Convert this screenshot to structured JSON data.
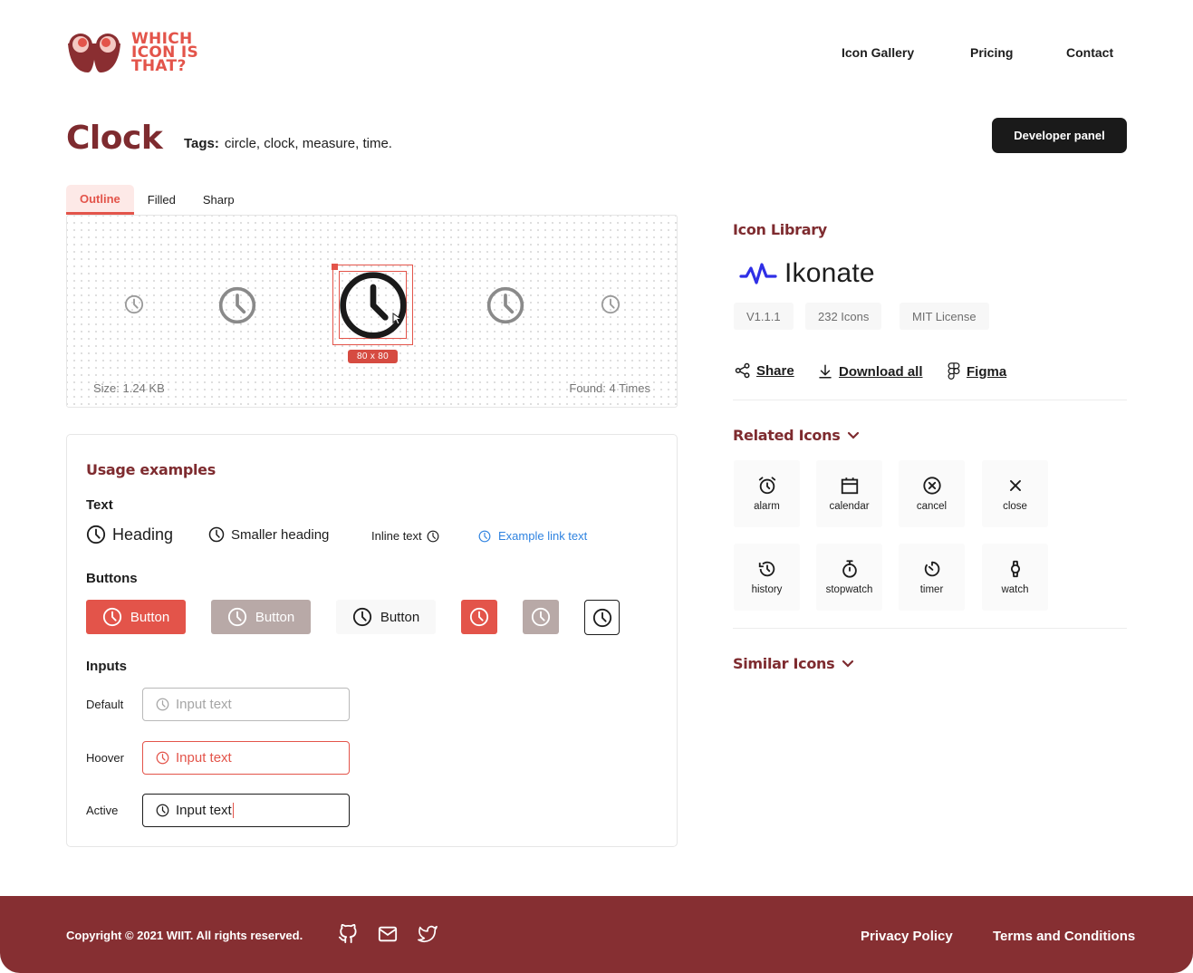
{
  "brand": {
    "logo_text": [
      "WHICH",
      "ICON IS",
      "THAT?"
    ],
    "primary": "#e3544a",
    "dark_accent": "#7e2b2f",
    "footer_bg": "#862f32"
  },
  "nav": {
    "gallery": "Icon Gallery",
    "pricing": "Pricing",
    "contact": "Contact"
  },
  "page": {
    "title": "Clock",
    "tags_label": "Tags:",
    "tags": "circle, clock, measure, time.",
    "developer_button": "Developer panel"
  },
  "tabs": [
    {
      "label": "Outline",
      "active": true
    },
    {
      "label": "Filled",
      "active": false
    },
    {
      "label": "Sharp",
      "active": false
    }
  ],
  "preview": {
    "icon": "clock-icon",
    "size_badge": "80 x 80",
    "size_text": "Size: 1.24 KB",
    "found_text": "Found: 4 Times"
  },
  "usage": {
    "title": "Usage examples",
    "text_section": {
      "label": "Text",
      "heading": "Heading",
      "smaller_heading": "Smaller heading",
      "inline_text": "Inline text",
      "link_text": "Example link text"
    },
    "buttons_section": {
      "label": "Buttons",
      "button_label": "Button"
    },
    "inputs_section": {
      "label": "Inputs",
      "rows": [
        {
          "label": "Default",
          "value": "Input text",
          "state": "default"
        },
        {
          "label": "Hoover",
          "value": "Input text",
          "state": "hover"
        },
        {
          "label": "Active",
          "value": "Input text",
          "state": "active"
        }
      ]
    }
  },
  "library": {
    "title": "Icon Library",
    "name": "Ikonate",
    "version": "V1.1.1",
    "count": "232 Icons",
    "license": "MIT License",
    "actions": {
      "share": "Share",
      "download": "Download all",
      "figma": "Figma"
    }
  },
  "related": {
    "title": "Related Icons",
    "items": [
      {
        "label": "alarm",
        "icon": "alarm-icon"
      },
      {
        "label": "calendar",
        "icon": "calendar-icon"
      },
      {
        "label": "cancel",
        "icon": "cancel-icon"
      },
      {
        "label": "close",
        "icon": "close-icon"
      },
      {
        "label": "history",
        "icon": "history-icon"
      },
      {
        "label": "stopwatch",
        "icon": "stopwatch-icon"
      },
      {
        "label": "timer",
        "icon": "timer-icon"
      },
      {
        "label": "watch",
        "icon": "watch-icon"
      }
    ]
  },
  "similar": {
    "title": "Similar Icons"
  },
  "footer": {
    "copyright": "Copyright © 2021 WIIT. All rights reserved.",
    "privacy": "Privacy Policy",
    "terms": "Terms and Conditions",
    "social_icons": [
      "github-icon",
      "mail-icon",
      "twitter-icon"
    ]
  }
}
